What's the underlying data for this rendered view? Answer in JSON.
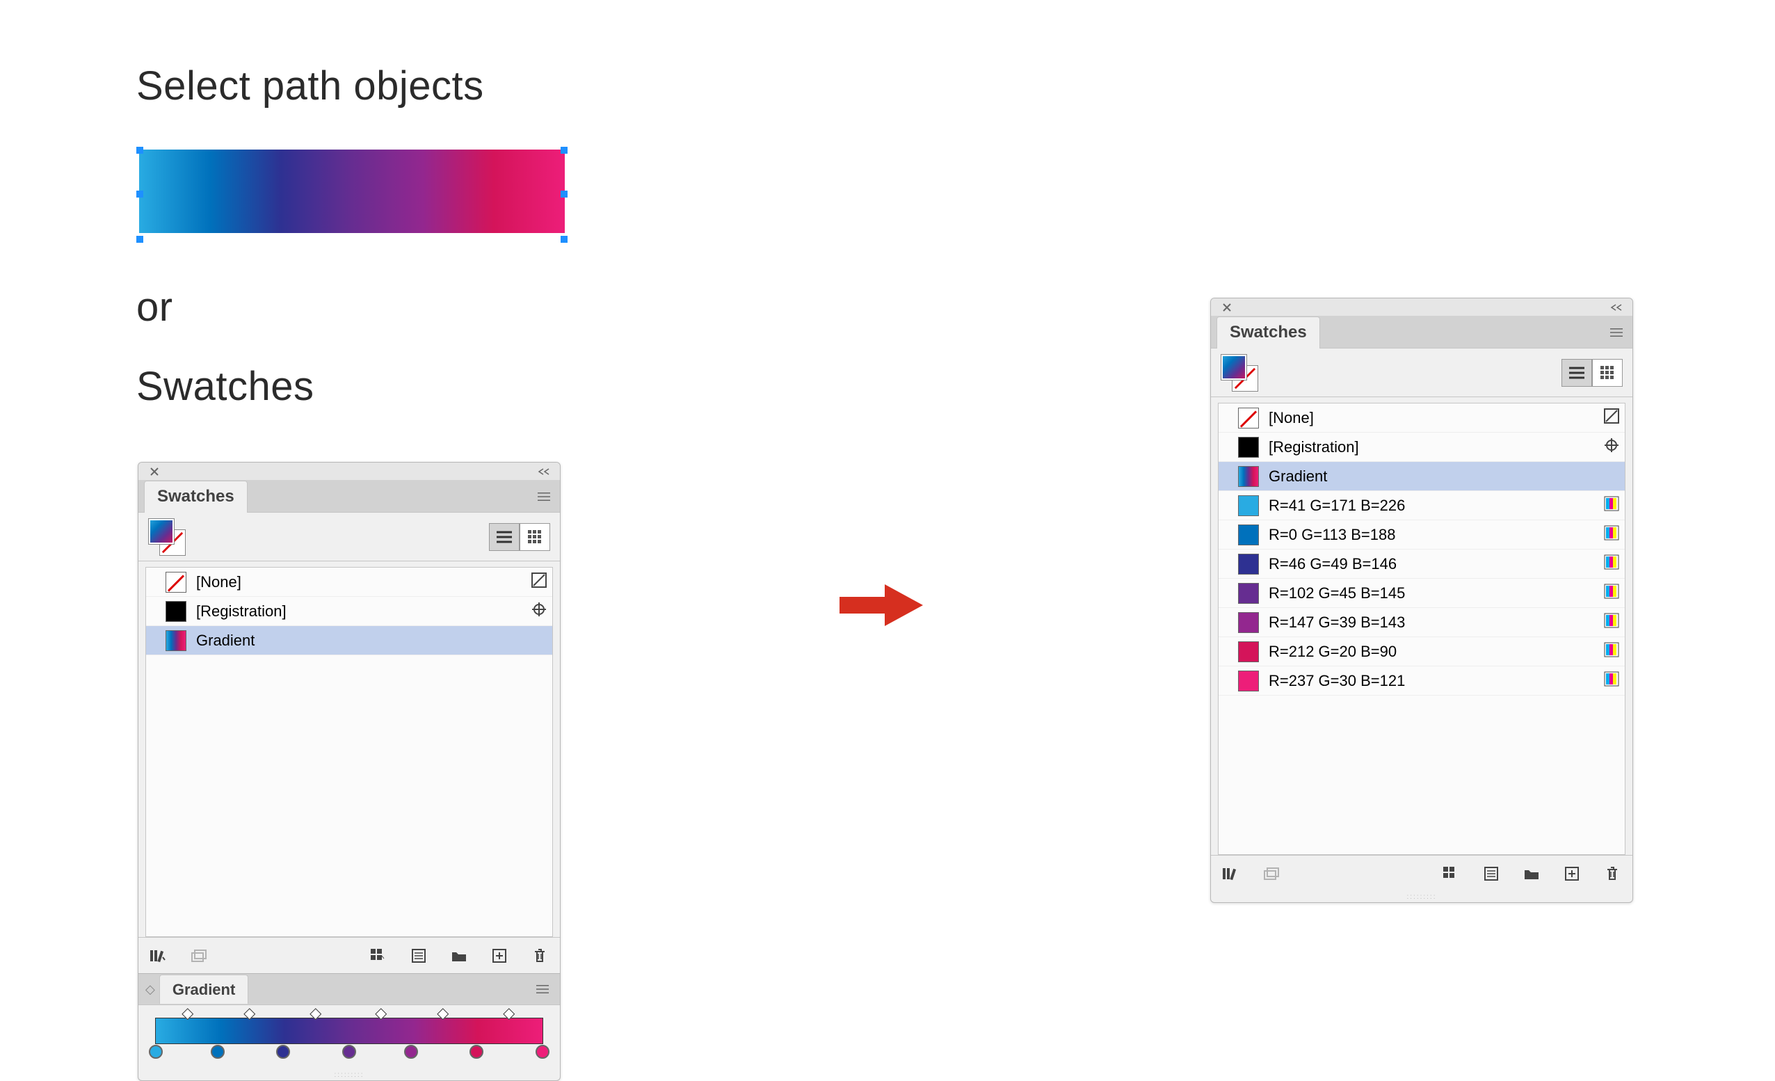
{
  "text": {
    "heading1": "Select path objects",
    "heading2": "or",
    "heading3": "Swatches"
  },
  "gradient_stops": [
    {
      "pos": 0,
      "color": "#29abe2"
    },
    {
      "pos": 16,
      "color": "#0071bc"
    },
    {
      "pos": 33,
      "color": "#2e3192"
    },
    {
      "pos": 50,
      "color": "#662d91"
    },
    {
      "pos": 66,
      "color": "#93278f"
    },
    {
      "pos": 83,
      "color": "#d4145a"
    },
    {
      "pos": 100,
      "color": "#ed1e79"
    }
  ],
  "midpoints": [
    8,
    24,
    41,
    58,
    74,
    91
  ],
  "panel_left": {
    "tab_label": "Swatches",
    "rows": [
      {
        "label": "[None]",
        "type": "none",
        "mini": "global-none"
      },
      {
        "label": "[Registration]",
        "type": "black",
        "mini": "registration"
      },
      {
        "label": "Gradient",
        "type": "gradient",
        "mini": "",
        "selected": true
      }
    ],
    "gradient_tab_label": "Gradient"
  },
  "panel_right": {
    "tab_label": "Swatches",
    "rows": [
      {
        "label": "[None]",
        "type": "none",
        "mini": "global-none"
      },
      {
        "label": "[Registration]",
        "type": "black",
        "mini": "registration"
      },
      {
        "label": "Gradient",
        "type": "gradient",
        "mini": "",
        "selected": true
      },
      {
        "label": "R=41 G=171 B=226",
        "type": "solid",
        "color": "#29abe2",
        "mini": "process"
      },
      {
        "label": "R=0 G=113 B=188",
        "type": "solid",
        "color": "#0071bc",
        "mini": "process"
      },
      {
        "label": "R=46 G=49 B=146",
        "type": "solid",
        "color": "#2e3192",
        "mini": "process"
      },
      {
        "label": "R=102 G=45 B=145",
        "type": "solid",
        "color": "#662d91",
        "mini": "process"
      },
      {
        "label": "R=147 G=39 B=143",
        "type": "solid",
        "color": "#93278f",
        "mini": "process"
      },
      {
        "label": "R=212 G=20 B=90",
        "type": "solid",
        "color": "#d4145a",
        "mini": "process"
      },
      {
        "label": "R=237 G=30 B=121",
        "type": "solid",
        "color": "#ed1e79",
        "mini": "process"
      }
    ]
  }
}
